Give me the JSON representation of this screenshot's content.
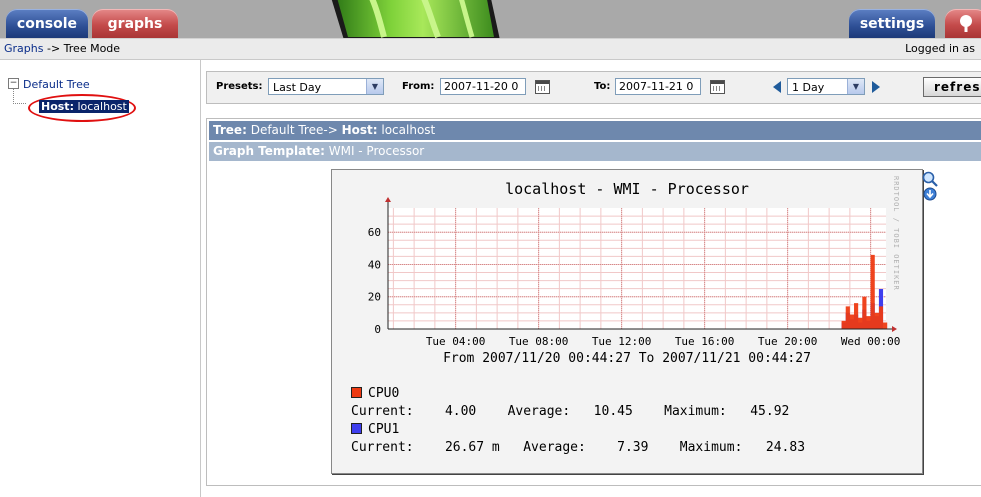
{
  "header": {
    "tabs": [
      {
        "label": "console"
      },
      {
        "label": "graphs"
      },
      {
        "label": "settings"
      }
    ]
  },
  "breadcrumb": {
    "link": "Graphs",
    "rest": "-> Tree Mode",
    "logged_in": "Logged in as"
  },
  "tree": {
    "root_label": "Default Tree",
    "host_prefix": "Host:",
    "host_name": "localhost"
  },
  "presets": {
    "presets_label": "Presets:",
    "presets_value": "Last Day",
    "from_label": "From:",
    "from_value": "2007-11-20 0",
    "to_label": "To:",
    "to_value": "2007-11-21 0",
    "span_value": "1 Day",
    "refresh_label": "refres"
  },
  "content": {
    "tree_header_prefix": "Tree:",
    "tree_header_value": "Default Tree->",
    "host_prefix": "Host:",
    "host_value": "localhost",
    "template_prefix": "Graph Template:",
    "template_value": "WMI - Processor"
  },
  "graph": {
    "title": "localhost - WMI - Processor",
    "credit": "RRDTOOL / TOBI OETIKER",
    "range": "From 2007/11/20 00:44:27 To 2007/11/21 00:44:27",
    "legend": [
      {
        "name": "CPU0",
        "color": "#ee3a12",
        "current_label": "Current:",
        "current": "4.00",
        "average_label": "Average:",
        "average": "10.45",
        "maximum_label": "Maximum:",
        "maximum": "45.92"
      },
      {
        "name": "CPU1",
        "color": "#3f3fee",
        "current_label": "Current:",
        "current": "26.67 m",
        "average_label": "Average:",
        "average": "7.39",
        "maximum_label": "Maximum:",
        "maximum": "24.83"
      }
    ]
  },
  "chart_data": {
    "type": "area",
    "title": "localhost - WMI - Processor",
    "xlabel": "",
    "ylabel": "",
    "x_tick_labels": [
      "Tue 04:00",
      "Tue 08:00",
      "Tue 12:00",
      "Tue 16:00",
      "Tue 20:00",
      "Wed 00:00"
    ],
    "x_range": [
      "2007/11/20 00:44:27",
      "2007/11/21 00:44:27"
    ],
    "y_ticks": [
      0,
      20,
      40,
      60
    ],
    "ylim": [
      0,
      75
    ],
    "grid": true,
    "x_hours": [
      22.6,
      22.8,
      23.0,
      23.2,
      23.4,
      23.6,
      23.8,
      24.0,
      24.2,
      24.4,
      24.6
    ],
    "series": [
      {
        "name": "CPU0",
        "color": "#ee3a12",
        "values": [
          5,
          14,
          9,
          16,
          7,
          20,
          8,
          45.92,
          10,
          14,
          4
        ]
      },
      {
        "name": "CPU1",
        "color": "#3f3fee",
        "values": [
          4,
          10,
          6,
          9,
          4,
          12,
          5,
          16,
          8,
          24.83,
          0.03
        ]
      }
    ]
  }
}
